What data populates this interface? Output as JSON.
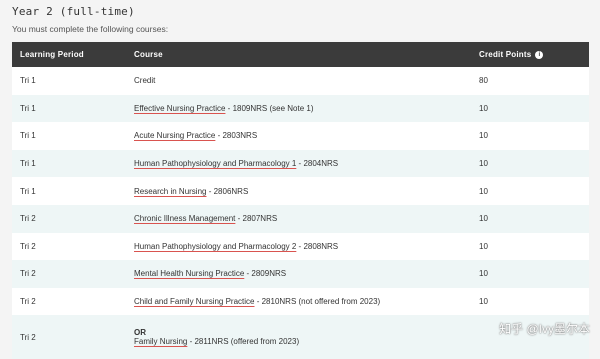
{
  "section_title": "Year 2 (full-time)",
  "intro": "You must complete the following courses:",
  "columns": {
    "period": "Learning Period",
    "course": "Course",
    "credits": "Credit Points"
  },
  "rows": [
    {
      "period": "Tri 1",
      "course": "Credit",
      "credits": "80"
    },
    {
      "period": "Tri 1",
      "course_link": "Effective Nursing Practice",
      "course_rest": " - 1809NRS (see Note 1)",
      "credits": "10"
    },
    {
      "period": "Tri 1",
      "course_link": "Acute Nursing Practice",
      "course_rest": " - 2803NRS",
      "credits": "10"
    },
    {
      "period": "Tri 1",
      "course_link": "Human Pathophysiology and Pharmacology 1",
      "course_rest": " - 2804NRS",
      "credits": "10"
    },
    {
      "period": "Tri 1",
      "course_link": "Research in Nursing",
      "course_rest": " - 2806NRS",
      "credits": "10"
    },
    {
      "period": "Tri 2",
      "course_link": "Chronic Illness Management",
      "course_rest": " - 2807NRS",
      "credits": "10"
    },
    {
      "period": "Tri 2",
      "course_link": "Human Pathophysiology and Pharmacology 2",
      "course_rest": " - 2808NRS",
      "credits": "10"
    },
    {
      "period": "Tri 2",
      "course_link": "Mental Health Nursing Practice",
      "course_rest": " - 2809NRS",
      "credits": "10"
    },
    {
      "period": "Tri 2",
      "course_link": "Child and Family Nursing Practice",
      "course_rest": " - 2810NRS (not offered from 2023)",
      "credits": "10"
    },
    {
      "period": "Tri 2",
      "or_label": "OR",
      "course_link": "Family Nursing",
      "course_rest": " - 2811NRS (offered from 2023)",
      "credits": ""
    }
  ],
  "watermark": "知乎 @Ivy墨尔本"
}
